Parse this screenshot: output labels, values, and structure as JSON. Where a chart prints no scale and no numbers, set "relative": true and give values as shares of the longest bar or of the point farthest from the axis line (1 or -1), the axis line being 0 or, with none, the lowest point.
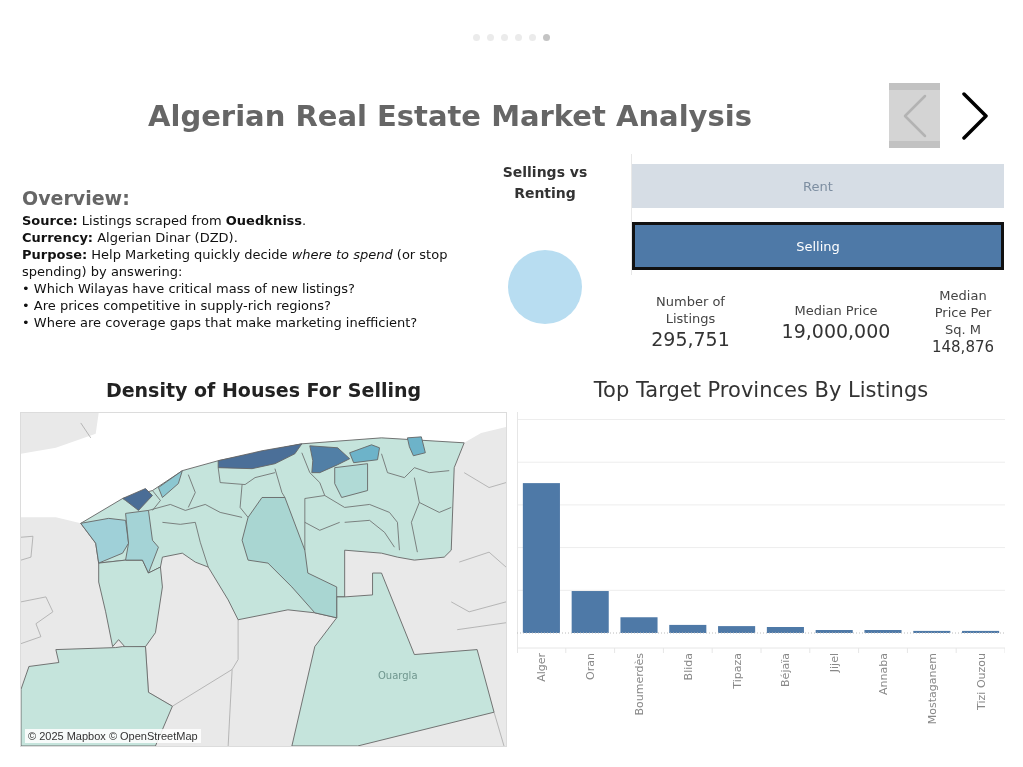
{
  "pager": {
    "dots": [
      {
        "selected": false
      },
      {
        "selected": false
      },
      {
        "selected": false
      },
      {
        "selected": false
      },
      {
        "selected": false
      },
      {
        "selected": true
      }
    ]
  },
  "title": "Algerian Real Estate Market Analysis",
  "navigation": {
    "previous": {
      "disabled": true
    },
    "next": {
      "disabled": false
    }
  },
  "overview": {
    "heading": "Overview:",
    "lines": [
      "**Source:** Listings scraped from **Ouedkniss**.",
      "**Currency:** Algerian Dinar (DZD).",
      "**Purpose:** Help Marketing quickly decide *where to spend* (or stop spending) by answering:",
      "• Which Wilayas have critical mass of new listings?",
      "• Are prices competitive in supply-rich regions?",
      "• Where are coverage gaps that make marketing inefficient?"
    ]
  },
  "segment_filter": {
    "title": "Sellings vs Renting",
    "options": [
      {
        "label": "Rent",
        "selected": false
      },
      {
        "label": "Selling",
        "selected": true
      }
    ]
  },
  "kpis": [
    {
      "label": "Number of Listings",
      "value": "295,751"
    },
    {
      "label": "Median Price",
      "value": "19,000,000"
    },
    {
      "label": "Median Price Per Sq. M",
      "value": "148,876"
    }
  ],
  "map": {
    "title": "Density of Houses For Selling",
    "place_label": "Ouargla",
    "attribution": "© 2025 Mapbox © OpenStreetMap"
  },
  "bar_chart": {
    "chart_data": {
      "type": "bar",
      "title": "Top Target Provinces By Listings",
      "categories": [
        "Alger",
        "Oran",
        "Boumerdès",
        "Blida",
        "Tipaza",
        "Béjaïa",
        "Jijel",
        "Annaba",
        "Mostaganem",
        "Tizi Ouzou"
      ],
      "values": [
        1,
        0.28,
        0.105,
        0.054,
        0.046,
        0.04,
        0.02,
        0.02,
        0.014,
        0.014
      ],
      "relative": true
    }
  }
}
